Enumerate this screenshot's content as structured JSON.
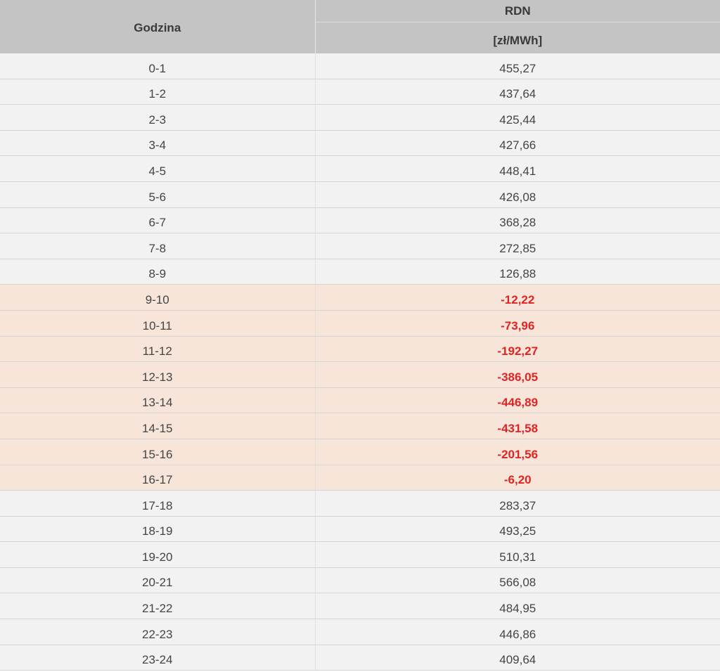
{
  "table": {
    "header": {
      "hour_label": "Godzina",
      "market_label": "RDN",
      "unit_label": "[zł/MWh]"
    },
    "highlight_color": "#f7e5d9",
    "negative_text_color": "#e02424",
    "rows": [
      {
        "hour": "0-1",
        "price": "455,27",
        "negative": false
      },
      {
        "hour": "1-2",
        "price": "437,64",
        "negative": false
      },
      {
        "hour": "2-3",
        "price": "425,44",
        "negative": false
      },
      {
        "hour": "3-4",
        "price": "427,66",
        "negative": false
      },
      {
        "hour": "4-5",
        "price": "448,41",
        "negative": false
      },
      {
        "hour": "5-6",
        "price": "426,08",
        "negative": false
      },
      {
        "hour": "6-7",
        "price": "368,28",
        "negative": false
      },
      {
        "hour": "7-8",
        "price": "272,85",
        "negative": false
      },
      {
        "hour": "8-9",
        "price": "126,88",
        "negative": false
      },
      {
        "hour": "9-10",
        "price": "-12,22",
        "negative": true
      },
      {
        "hour": "10-11",
        "price": "-73,96",
        "negative": true
      },
      {
        "hour": "11-12",
        "price": "-192,27",
        "negative": true
      },
      {
        "hour": "12-13",
        "price": "-386,05",
        "negative": true
      },
      {
        "hour": "13-14",
        "price": "-446,89",
        "negative": true
      },
      {
        "hour": "14-15",
        "price": "-431,58",
        "negative": true
      },
      {
        "hour": "15-16",
        "price": "-201,56",
        "negative": true
      },
      {
        "hour": "16-17",
        "price": "-6,20",
        "negative": true
      },
      {
        "hour": "17-18",
        "price": "283,37",
        "negative": false
      },
      {
        "hour": "18-19",
        "price": "493,25",
        "negative": false
      },
      {
        "hour": "19-20",
        "price": "510,31",
        "negative": false
      },
      {
        "hour": "20-21",
        "price": "566,08",
        "negative": false
      },
      {
        "hour": "21-22",
        "price": "484,95",
        "negative": false
      },
      {
        "hour": "22-23",
        "price": "446,86",
        "negative": false
      },
      {
        "hour": "23-24",
        "price": "409,64",
        "negative": false
      }
    ]
  }
}
